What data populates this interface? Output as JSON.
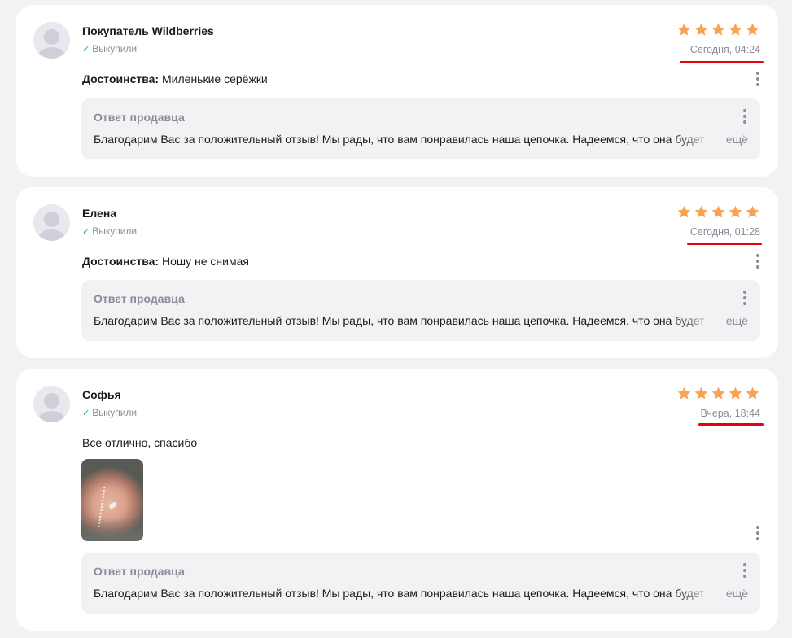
{
  "colors": {
    "star": "#f8a354",
    "check": "#22b573",
    "underline": "#e8000f",
    "muted": "#8b8b99"
  },
  "reviews": [
    {
      "author": "Покупатель Wildberries",
      "bought_label": "Выкупили",
      "rating": 5,
      "date": "Сегодня, 04:24",
      "text_label": "Достоинства:",
      "text": "Миленькие серёжки",
      "answer": {
        "title": "Ответ продавца",
        "text": "Благодарим Вас за положительный отзыв! Мы рады, что вам понравилась наша цепочка. Надеемся, что она будет",
        "more": "ещё"
      }
    },
    {
      "author": "Елена",
      "bought_label": "Выкупили",
      "rating": 5,
      "date": "Сегодня, 01:28",
      "text_label": "Достоинства:",
      "text": "Ношу не снимая",
      "answer": {
        "title": "Ответ продавца",
        "text": "Благодарим Вас за положительный отзыв! Мы рады, что вам понравилась наша цепочка. Надеемся, что она будет",
        "more": "ещё"
      }
    },
    {
      "author": "Софья",
      "bought_label": "Выкупили",
      "rating": 5,
      "date": "Вчера, 18:44",
      "text": "Все отлично, спасибо",
      "answer": {
        "title": "Ответ продавца",
        "text": "Благодарим Вас за положительный отзыв! Мы рады, что вам понравилась наша цепочка. Надеемся, что она будет",
        "more": "ещё"
      }
    }
  ]
}
